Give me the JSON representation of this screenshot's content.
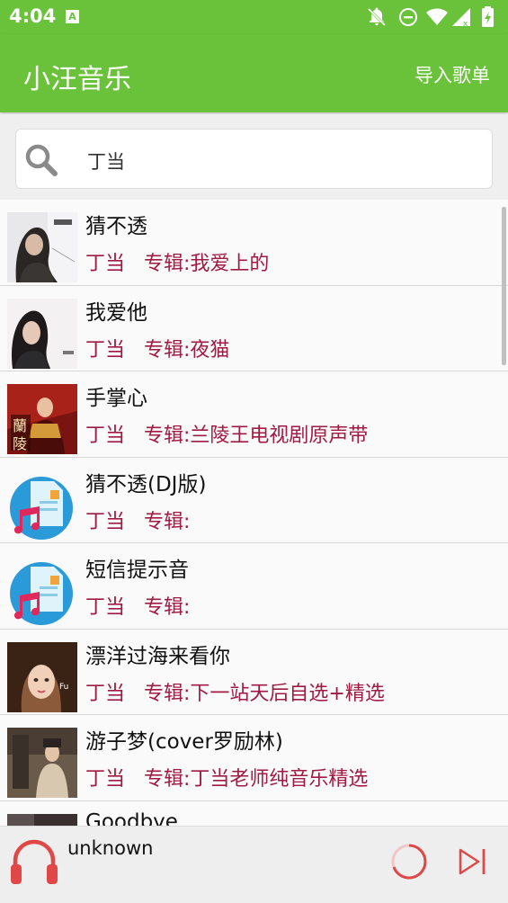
{
  "status_bar": {
    "time": "4:04",
    "sim_label": "A",
    "icons": [
      "notifications-off-icon",
      "do-not-disturb-icon",
      "wifi-icon",
      "signal-icon",
      "battery-charging-icon"
    ]
  },
  "app_bar": {
    "title": "小汪音乐",
    "import_label": "导入歌单"
  },
  "search": {
    "value": "丁当"
  },
  "songs": [
    {
      "title": "猜不透",
      "artist": "丁当",
      "album": "专辑:我爱上的",
      "cover": "photo-cover-1"
    },
    {
      "title": "我爱他",
      "artist": "丁当",
      "album": "专辑:夜猫",
      "cover": "photo-cover-2"
    },
    {
      "title": "手掌心",
      "artist": "丁当",
      "album": "专辑:兰陵王电视剧原声带",
      "cover": "photo-cover-3"
    },
    {
      "title": "猜不透(DJ版)",
      "artist": "丁当",
      "album": "专辑:",
      "cover": "default-music-icon"
    },
    {
      "title": "短信提示音",
      "artist": "丁当",
      "album": "专辑:",
      "cover": "default-music-icon"
    },
    {
      "title": "漂洋过海来看你",
      "artist": "丁当",
      "album": "专辑:下一站天后自选+精选",
      "cover": "photo-cover-4"
    },
    {
      "title": "游子梦(cover罗励林)",
      "artist": "丁当",
      "album": "专辑:丁当老师纯音乐精选",
      "cover": "photo-cover-5"
    },
    {
      "title": "Goodbye",
      "artist": "",
      "album": "",
      "cover": "photo-cover-6"
    }
  ],
  "player": {
    "track_name": "unknown"
  },
  "colors": {
    "primary_green": "#6ac23a",
    "artist_text": "#a11a43",
    "player_accent": "#e04848"
  }
}
